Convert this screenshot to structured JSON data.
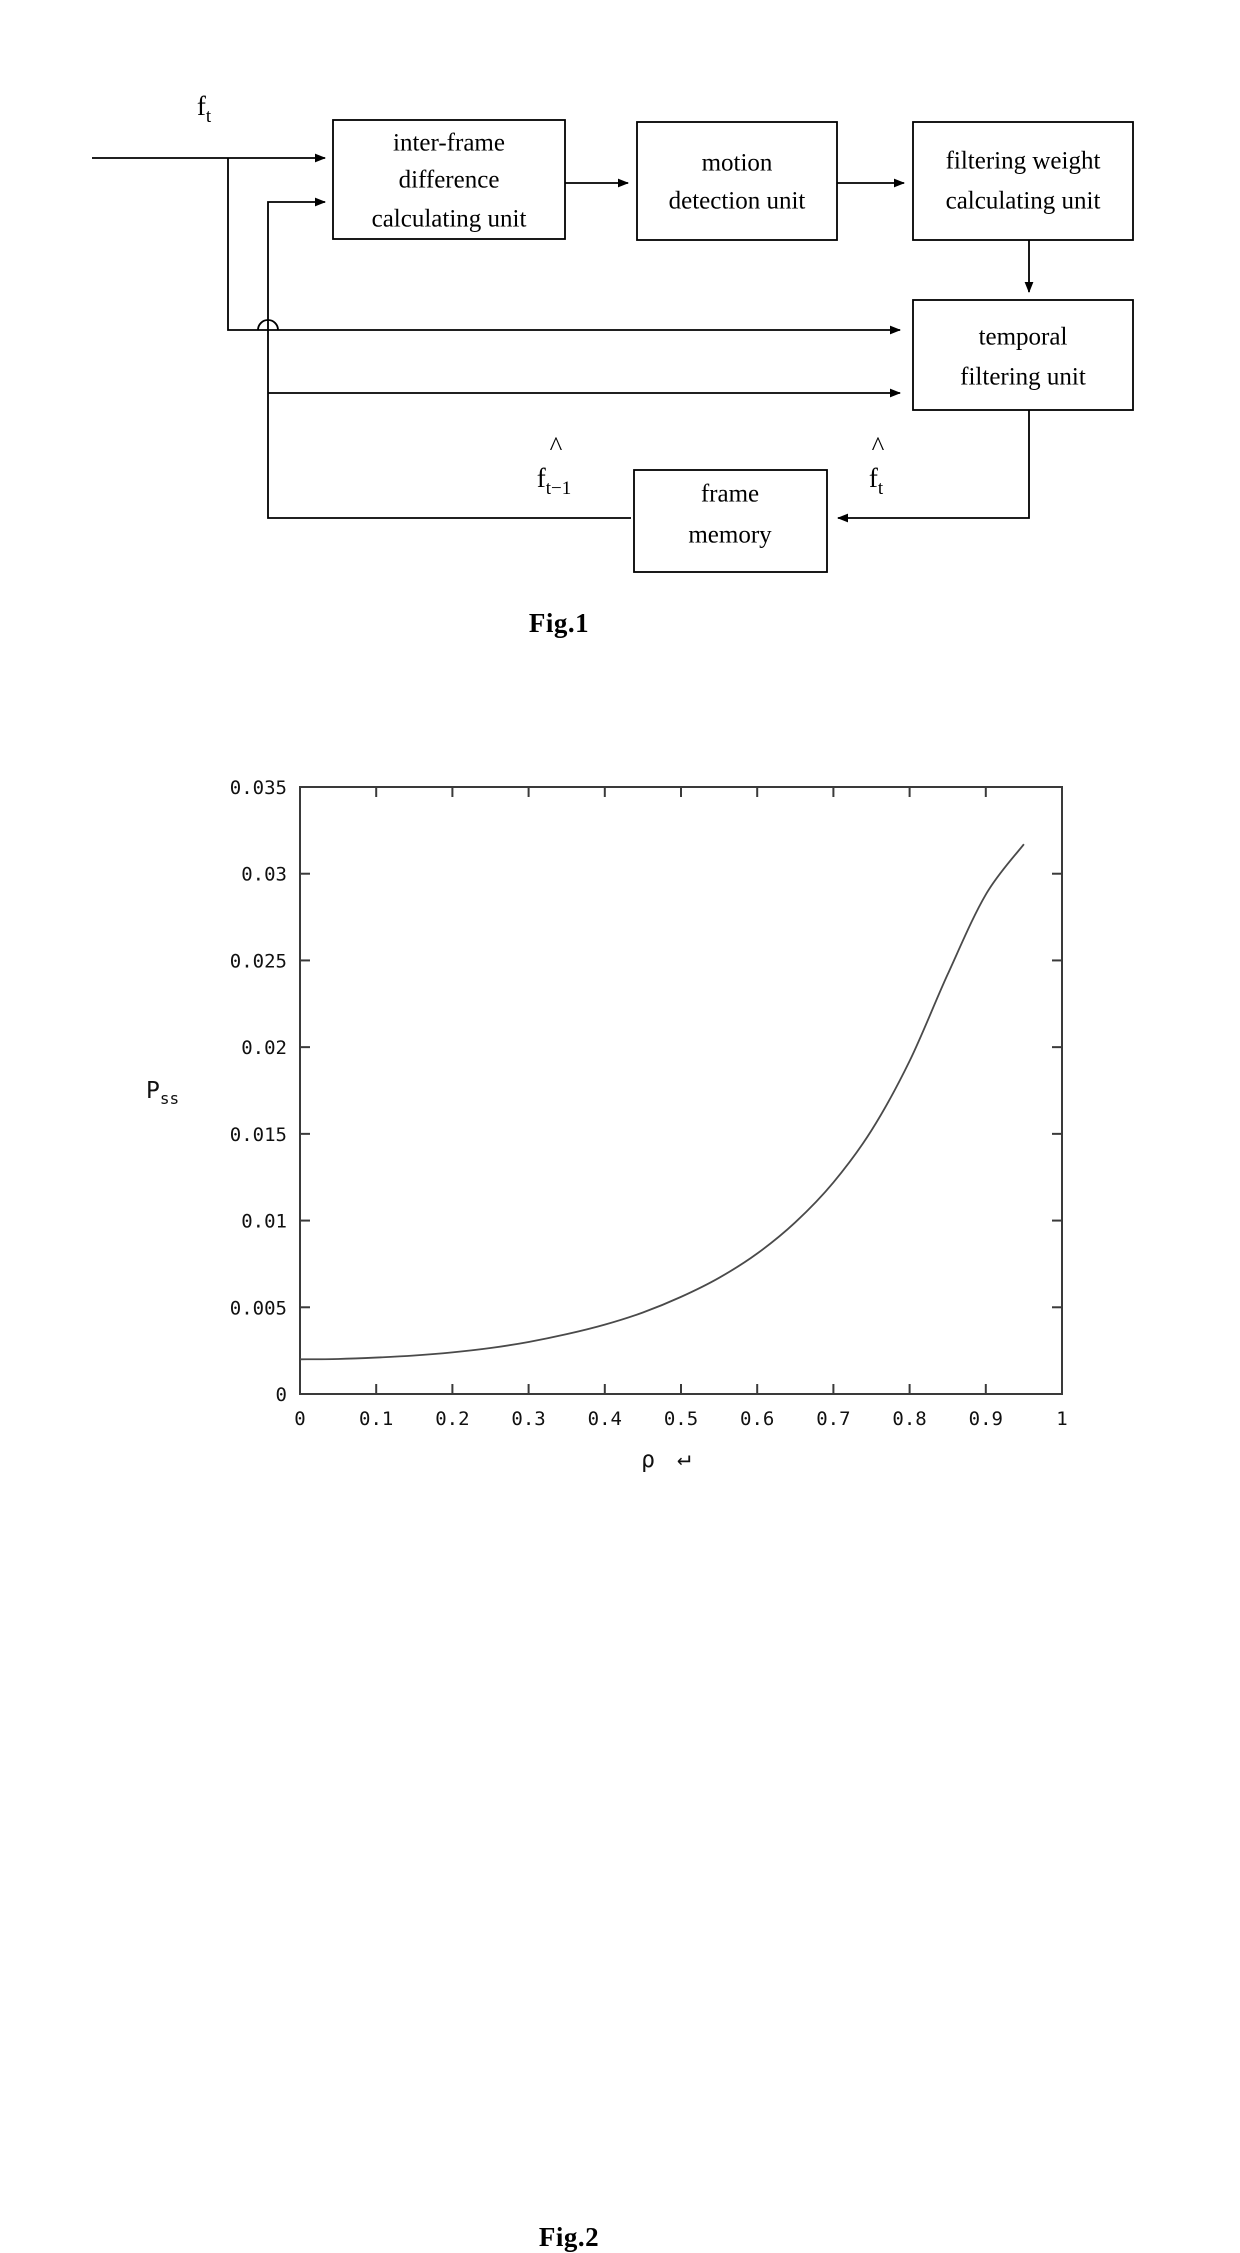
{
  "figures": {
    "fig1": {
      "caption": "Fig.1",
      "input_signal_label": "f",
      "input_signal_sub": "t",
      "blocks": [
        {
          "id": "inter-frame-difference-calculating-unit",
          "lines": [
            "inter-frame",
            "difference",
            "calculating unit"
          ]
        },
        {
          "id": "motion-detection-unit",
          "lines": [
            "motion",
            "detection unit"
          ]
        },
        {
          "id": "filtering-weight-calculating-unit",
          "lines": [
            "filtering weight",
            "calculating unit"
          ]
        },
        {
          "id": "temporal-filtering-unit",
          "lines": [
            "temporal",
            "filtering unit"
          ]
        },
        {
          "id": "frame-memory",
          "lines": [
            "frame",
            "memory"
          ]
        }
      ],
      "signal_prev": {
        "base": "f",
        "sub": "t−1",
        "hat": "^"
      },
      "signal_cur": {
        "base": "f",
        "sub": "t",
        "hat": "^"
      }
    },
    "fig2": {
      "caption": "Fig.2"
    }
  },
  "chart_data": {
    "type": "line",
    "title": "",
    "xlabel": "ρ",
    "xlabel_suffix": "↵",
    "ylabel": "P",
    "ylabel_sub": "ss",
    "xlim": [
      0,
      1
    ],
    "ylim": [
      0,
      0.035
    ],
    "grid": false,
    "legend": "none",
    "xticks": [
      0,
      0.1,
      0.2,
      0.3,
      0.4,
      0.5,
      0.6,
      0.7,
      0.8,
      0.9,
      1
    ],
    "xtick_labels": [
      "0",
      "0.1",
      "0.2",
      "0.3",
      "0.4",
      "0.5",
      "0.6",
      "0.7",
      "0.8",
      "0.9",
      "1"
    ],
    "yticks": [
      0,
      0.005,
      0.01,
      0.015,
      0.02,
      0.025,
      0.03,
      0.035
    ],
    "ytick_labels": [
      "0",
      "0.005",
      "0.01",
      "0.015",
      "0.02",
      "0.025",
      "0.03",
      "0.035"
    ],
    "series": [
      {
        "name": "Pss",
        "x": [
          0.0,
          0.05,
          0.1,
          0.15,
          0.2,
          0.25,
          0.3,
          0.35,
          0.4,
          0.45,
          0.5,
          0.55,
          0.6,
          0.65,
          0.7,
          0.75,
          0.8,
          0.85,
          0.9,
          0.95
        ],
        "values": [
          0.002,
          0.00202,
          0.0021,
          0.00222,
          0.0024,
          0.00265,
          0.003,
          0.00345,
          0.004,
          0.0047,
          0.0056,
          0.0067,
          0.0081,
          0.0099,
          0.0122,
          0.0152,
          0.0192,
          0.0242,
          0.0288,
          0.0317
        ]
      }
    ]
  }
}
